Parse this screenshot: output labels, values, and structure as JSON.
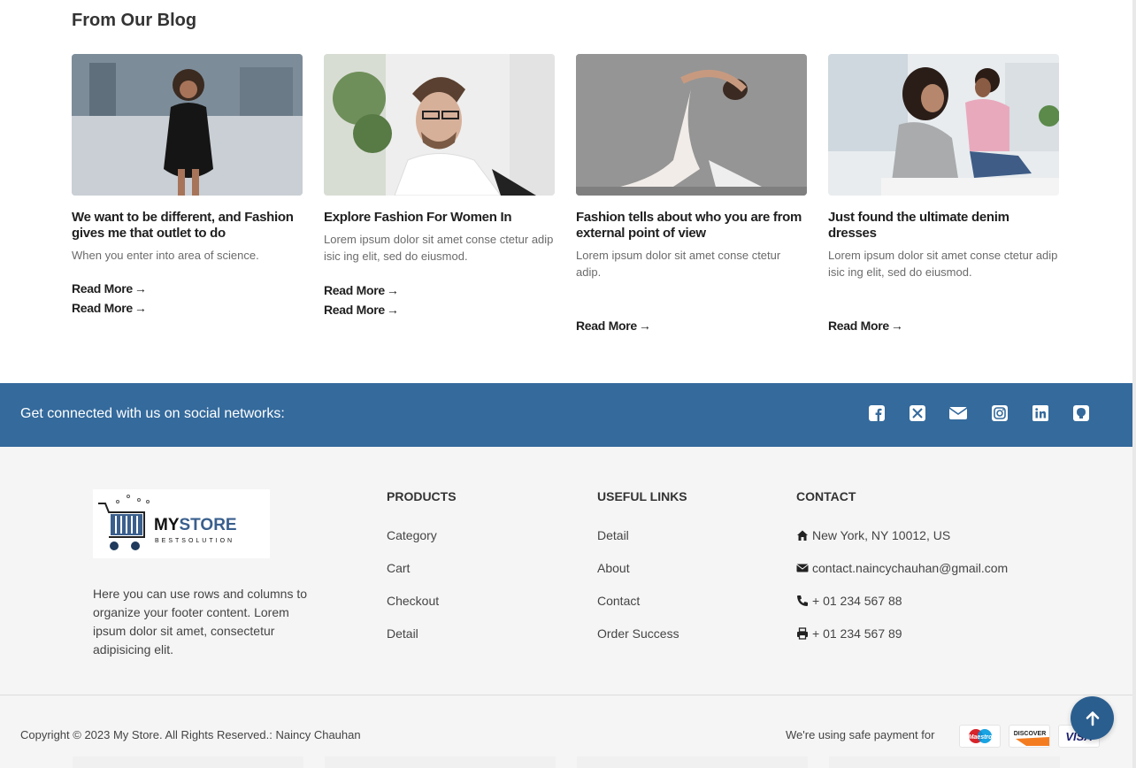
{
  "blog": {
    "title": "From Our Blog",
    "posts": [
      {
        "title": "We want to be different, and Fashion gives me that outlet to do",
        "description": "When you enter into area of science.",
        "read_more": [
          "Read More",
          "Read More"
        ]
      },
      {
        "title": "Explore Fashion For Women In",
        "description": "Lorem ipsum dolor sit amet conse ctetur adip isic ing elit, sed do eiusmod.",
        "read_more": [
          "Read More",
          "Read More"
        ]
      },
      {
        "title": "Fashion tells about who you are from external point of view",
        "description": "Lorem ipsum dolor sit amet conse ctetur adip.",
        "read_more": [
          "Read More"
        ]
      },
      {
        "title": "Just found the ultimate denim dresses",
        "description": "Lorem ipsum dolor sit amet conse ctetur adip isic ing elit, sed do eiusmod.",
        "read_more": [
          "Read More"
        ]
      }
    ]
  },
  "social": {
    "text": "Get connected with us on social networks:",
    "icons": [
      "facebook-icon",
      "x-twitter-icon",
      "envelope-icon",
      "instagram-icon",
      "linkedin-icon",
      "github-icon"
    ]
  },
  "footer": {
    "logo": {
      "brand": "MYSTORE",
      "brand_a": "MY",
      "brand_b": "STORE",
      "tagline": "BESTSOLUTION"
    },
    "about": "Here you can use rows and columns to organize your footer content. Lorem ipsum dolor sit amet, consectetur adipisicing elit.",
    "products": {
      "heading": "PRODUCTS",
      "links": [
        "Category",
        "Cart",
        "Checkout",
        "Detail"
      ]
    },
    "useful_links": {
      "heading": "USEFUL LINKS",
      "links": [
        "Detail",
        "About",
        "Contact",
        "Order Success"
      ]
    },
    "contact": {
      "heading": "CONTACT",
      "address": "New York, NY 10012, US",
      "email": "contact.naincychauhan@gmail.com",
      "phone": "+ 01 234 567 88",
      "fax": "+ 01 234 567 89"
    },
    "copyright": "Copyright © 2023 My Store. All Rights Reserved.: Naincy Chauhan",
    "payment_text": "We're using safe payment for",
    "payment_cards": [
      "Maestro",
      "DISCOVER",
      "VISA"
    ]
  },
  "colors": {
    "social_bar": "#346a9c",
    "scroll_button": "#2a5e8f"
  }
}
